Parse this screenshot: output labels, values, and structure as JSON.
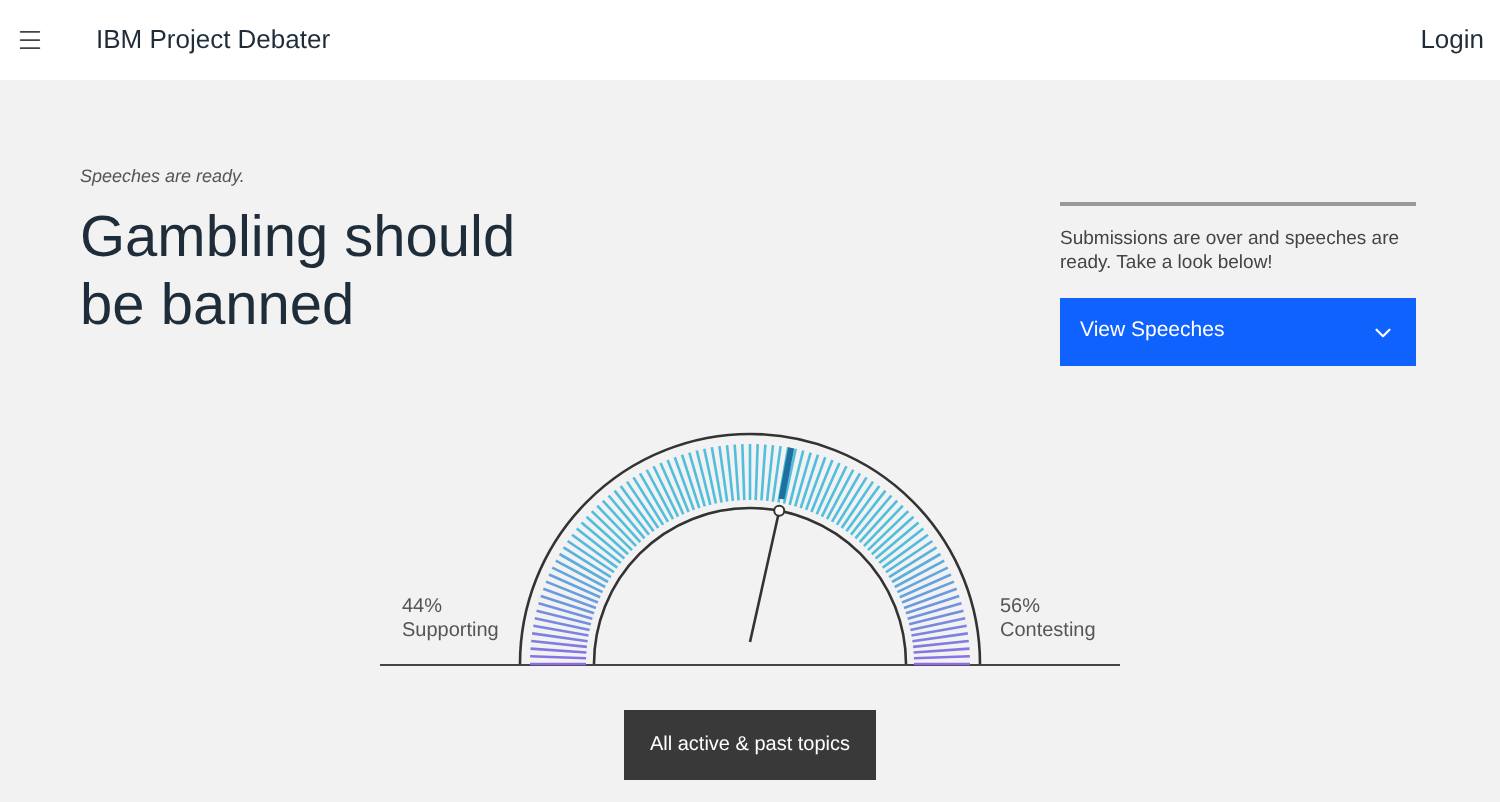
{
  "header": {
    "title": "IBM Project Debater",
    "login": "Login"
  },
  "status": "Speeches are ready.",
  "topic": "Gambling should be banned",
  "panel": {
    "message": "Submissions are over and speeches are ready. Take a look below!",
    "button": "View Speeches"
  },
  "gauge": {
    "left_percent": "44%",
    "left_label": "Supporting",
    "right_percent": "56%",
    "right_label": "Contesting"
  },
  "topics_button": "All active & past topics"
}
